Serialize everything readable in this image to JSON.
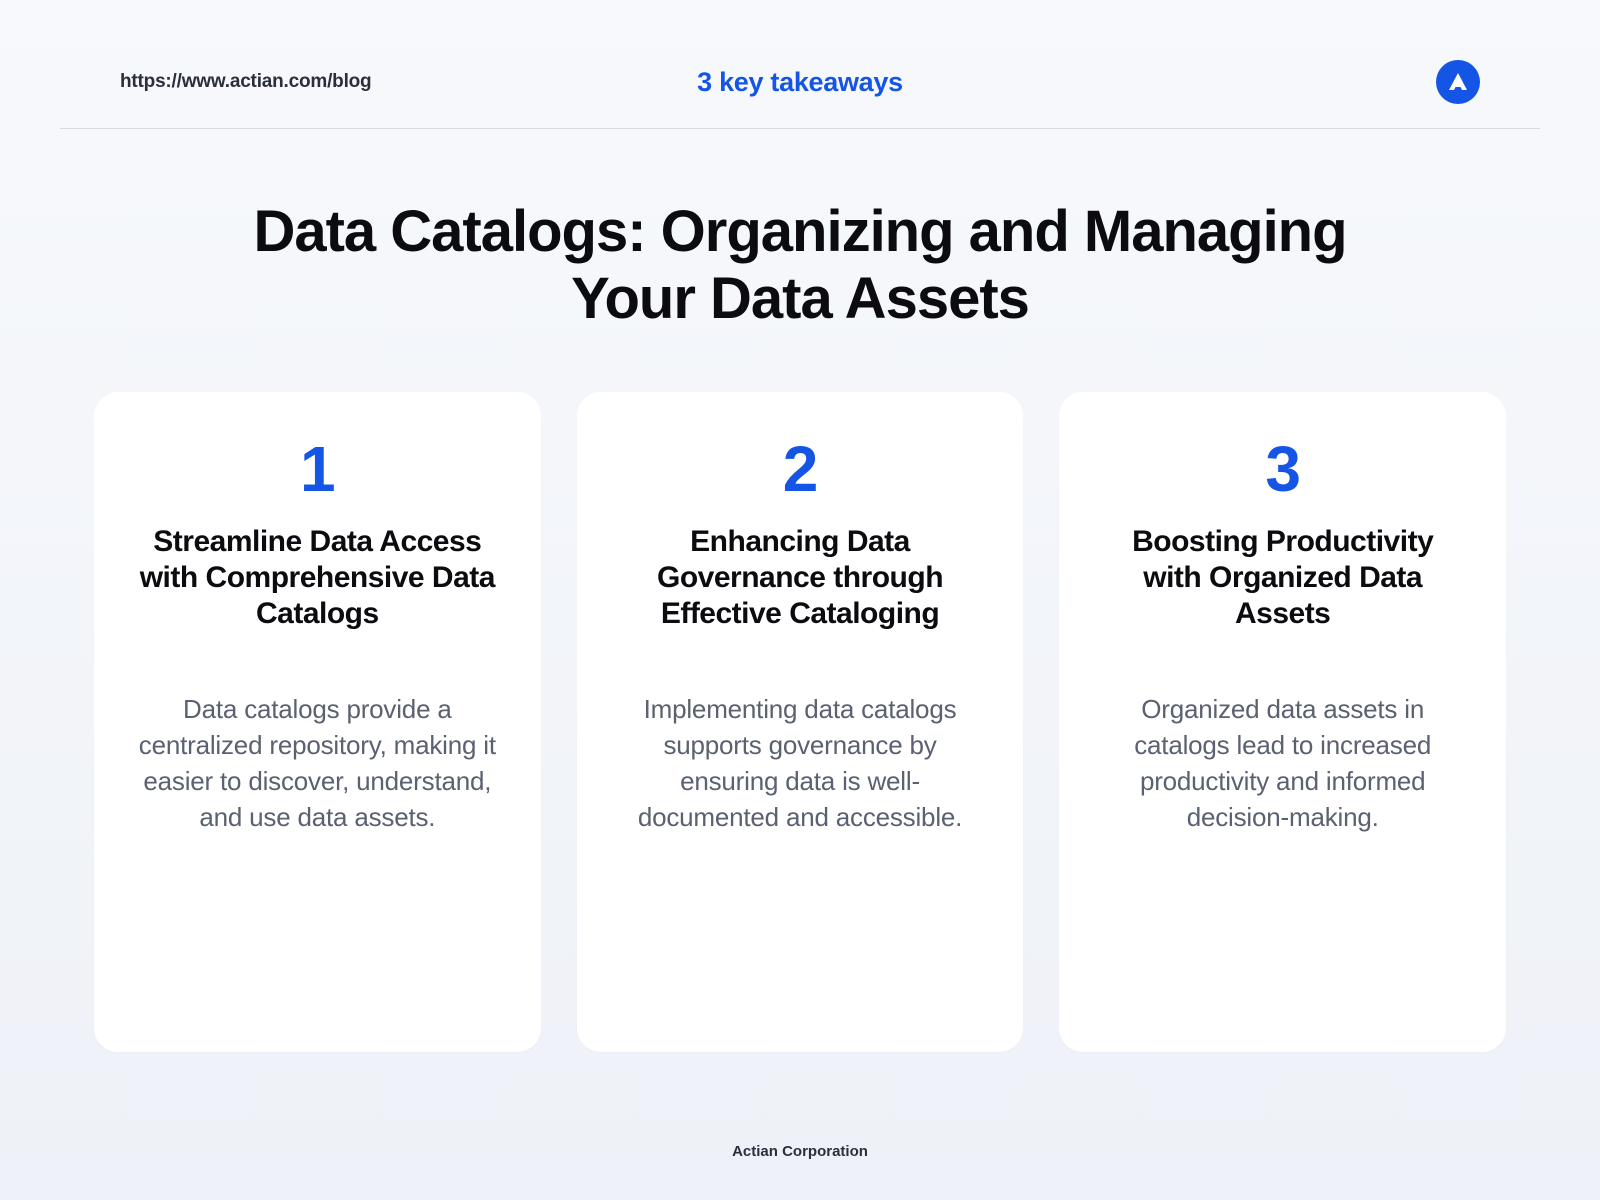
{
  "header": {
    "url": "https://www.actian.com/blog",
    "tag": "3 key takeaways"
  },
  "title": "Data Catalogs: Organizing and Managing Your Data Assets",
  "cards": [
    {
      "num": "1",
      "title": "Streamline Data Access with Comprehensive Data Catalogs",
      "body": "Data catalogs provide a centralized repository, making it easier to discover, understand, and use data assets."
    },
    {
      "num": "2",
      "title": "Enhancing Data Governance through Effective Cataloging",
      "body": "Implementing data catalogs supports governance by ensuring data is well-documented and accessible."
    },
    {
      "num": "3",
      "title": "Boosting Productivity with Organized Data Assets",
      "body": "Organized data assets in catalogs lead to increased productivity and informed decision-making."
    }
  ],
  "footer": "Actian Corporation"
}
